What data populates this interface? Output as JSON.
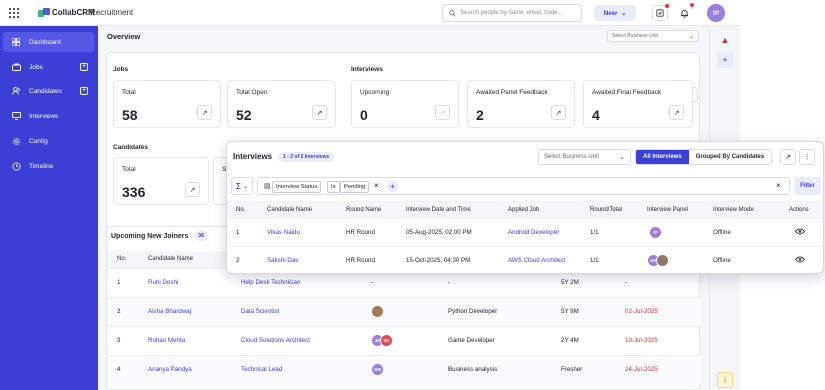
{
  "app": {
    "brand": "CollabCRM",
    "module": "Recruitment"
  },
  "search": {
    "placeholder": "Search people by name, email, code..."
  },
  "header": {
    "new_label": "New",
    "avatar_initials": "IP"
  },
  "sidebar": {
    "items": [
      {
        "label": "Dashboard",
        "icon": "dashboard-icon",
        "active": true
      },
      {
        "label": "Jobs",
        "icon": "briefcase-icon"
      },
      {
        "label": "Candidates",
        "icon": "users-icon"
      },
      {
        "label": "Interviews",
        "icon": "monitor-icon"
      },
      {
        "label": "Config",
        "icon": "gear-icon"
      },
      {
        "label": "Timeline",
        "icon": "clock-icon"
      }
    ]
  },
  "overview": {
    "title": "Overview",
    "business_unit_placeholder": "Select Business Unit",
    "jobs_label": "Jobs",
    "interviews_label": "Interviews",
    "candidates_label": "Candidates",
    "jobs": [
      {
        "label": "Total",
        "value": "58"
      },
      {
        "label": "Total Open",
        "value": "52"
      }
    ],
    "interviews": [
      {
        "label": "Upcoming",
        "value": "0"
      },
      {
        "label": "Awaited Panel Feedback",
        "value": "2"
      },
      {
        "label": "Awaited Final Feedback",
        "value": "4"
      }
    ],
    "candidates": [
      {
        "label": "Total",
        "value": "336"
      },
      {
        "label": "Se"
      }
    ]
  },
  "joiners": {
    "title": "Upcoming New Joiners",
    "count": "36",
    "columns": [
      "No.",
      "Candidate Name"
    ],
    "rows": [
      {
        "no": "1",
        "name": "Ruhi Doshi",
        "job": "Help Desk Technician",
        "panel": "-",
        "role": "-",
        "exp": "5Y 2M",
        "date": "-"
      },
      {
        "no": "2",
        "name": "Aisha Bhardwaj",
        "job": "Data Scientist",
        "panel": "",
        "role": "Python Developer",
        "exp": "5Y 9M",
        "date": "02-Jul-2025"
      },
      {
        "no": "3",
        "name": "Rohan Mehta",
        "job": "Cloud Solutions Architect",
        "panel": "JK SD",
        "role": "Game Developer",
        "exp": "2Y 4M",
        "date": "19-Jul-2025"
      },
      {
        "no": "4",
        "name": "Ananya Pandya",
        "job": "Technical Lead",
        "panel": "SM",
        "role": "Business analysis",
        "exp": "Fresher",
        "date": "24-Jul-2025"
      }
    ]
  },
  "interviews_panel": {
    "title": "Interviews",
    "count_text": "1 - 2 of 2 Interviews",
    "business_unit_placeholder": "Select Business Unit",
    "tabs": [
      "All Interviews",
      "Grouped By Candidates"
    ],
    "filter": {
      "field": "Interview Status",
      "op": "Is",
      "value": "Pending",
      "button": "Filter"
    },
    "columns": [
      "No.",
      "Candidate Name",
      "Round Name",
      "Interview Date and Time",
      "Applied Job",
      "Round/Total",
      "Interview Panel",
      "Interview Mode",
      "Actions"
    ],
    "rows": [
      {
        "no": "1",
        "name": "Vikas Naidu",
        "round": "HR Round",
        "datetime": "05-Aug-2025, 02:00 PM",
        "job": "Android Developer",
        "rt": "1/1",
        "panel": "IP",
        "mode": "Offline"
      },
      {
        "no": "2",
        "name": "Sakshi Das",
        "round": "HR Round",
        "datetime": "15-Oct-2025, 04:30 PM",
        "job": "AWS Cloud Architect",
        "rt": "1/1",
        "panel": "AM",
        "mode": "Offline"
      }
    ]
  },
  "colors": {
    "primary": "#3b3fd6",
    "danger": "#d93030",
    "avatar": "#9b7fe0"
  }
}
